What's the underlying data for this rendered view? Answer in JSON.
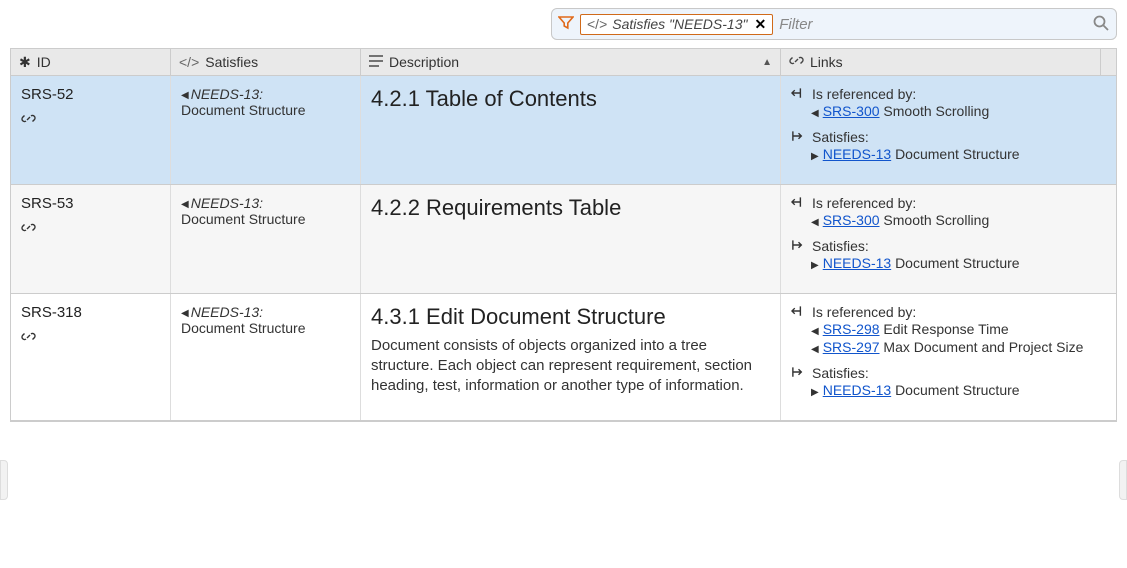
{
  "filter": {
    "chip_prefix_icon": "</>",
    "chip_text": "Satisfies \"NEEDS-13\"",
    "placeholder": "Filter"
  },
  "columns": {
    "id": "ID",
    "satisfies": "Satisfies",
    "description": "Description",
    "links": "Links"
  },
  "link_groups": {
    "referenced_by": "Is referenced by:",
    "satisfies": "Satisfies:"
  },
  "rows": [
    {
      "id": "SRS-52",
      "selected": true,
      "satisfies": {
        "id": "NEEDS-13:",
        "label": "Document Structure"
      },
      "desc": {
        "title": "4.2.1 Table of Contents",
        "body": ""
      },
      "links": {
        "referenced_by": [
          {
            "id": "SRS-300",
            "label": "Smooth Scrolling"
          }
        ],
        "satisfies": [
          {
            "id": "NEEDS-13",
            "label": "Document Structure"
          }
        ]
      }
    },
    {
      "id": "SRS-53",
      "selected": false,
      "alt": true,
      "satisfies": {
        "id": "NEEDS-13:",
        "label": "Document Structure"
      },
      "desc": {
        "title": "4.2.2 Requirements Table",
        "body": ""
      },
      "links": {
        "referenced_by": [
          {
            "id": "SRS-300",
            "label": "Smooth Scrolling"
          }
        ],
        "satisfies": [
          {
            "id": "NEEDS-13",
            "label": "Document Structure"
          }
        ]
      }
    },
    {
      "id": "SRS-318",
      "selected": false,
      "satisfies": {
        "id": "NEEDS-13:",
        "label": "Document Structure"
      },
      "desc": {
        "title": "4.3.1 Edit Document Structure",
        "body": "Document consists of objects organized into a tree structure. Each object can represent requirement, section heading, test, information or another type of information."
      },
      "links": {
        "referenced_by": [
          {
            "id": "SRS-298",
            "label": "Edit Response Time"
          },
          {
            "id": "SRS-297",
            "label": "Max Document and Project Size"
          }
        ],
        "satisfies": [
          {
            "id": "NEEDS-13",
            "label": "Document Structure"
          }
        ]
      }
    }
  ]
}
